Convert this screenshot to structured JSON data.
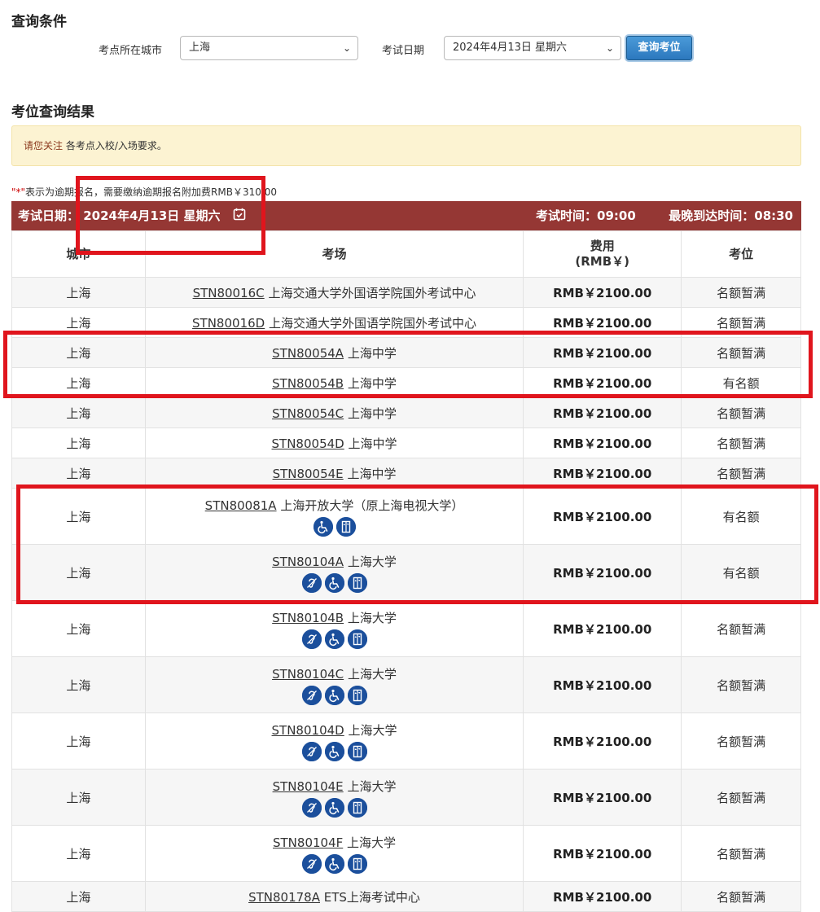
{
  "query": {
    "title": "查询条件",
    "city_label": "考点所在城市",
    "city_value": "上海",
    "date_label": "考试日期",
    "date_value": "2024年4月13日 星期六",
    "button": "查询考位"
  },
  "results": {
    "title": "考位查询结果",
    "notice_highlight": "请您关注",
    "notice_text": " 各考点入校/入场要求。",
    "late_note_mark": "\"*\"",
    "late_note_text": "表示为逾期报名，需要缴纳逾期报名附加费RMB￥310.00",
    "band_date": "考试日期：  2024年4月13日 星期六",
    "band_time": "考试时间：09:00",
    "band_arrive": "最晚到达时间：08:30",
    "headers": {
      "city": "城市",
      "venue": "考场",
      "fee_line1": "费用",
      "fee_line2": "(RMB￥)",
      "seat": "考位"
    },
    "rows": [
      {
        "city": "上海",
        "code": "STN80016C",
        "name": " 上海交通大学外国语学院国外考试中心",
        "fee": "RMB￥2100.00",
        "seat": "名额暂满",
        "icons": []
      },
      {
        "city": "上海",
        "code": "STN80016D",
        "name": " 上海交通大学外国语学院国外考试中心",
        "fee": "RMB￥2100.00",
        "seat": "名额暂满",
        "icons": []
      },
      {
        "city": "上海",
        "code": "STN80054A",
        "name": " 上海中学",
        "fee": "RMB￥2100.00",
        "seat": "名额暂满",
        "icons": []
      },
      {
        "city": "上海",
        "code": "STN80054B",
        "name": " 上海中学",
        "fee": "RMB￥2100.00",
        "seat": "有名额",
        "icons": []
      },
      {
        "city": "上海",
        "code": "STN80054C",
        "name": " 上海中学",
        "fee": "RMB￥2100.00",
        "seat": "名额暂满",
        "icons": []
      },
      {
        "city": "上海",
        "code": "STN80054D",
        "name": " 上海中学",
        "fee": "RMB￥2100.00",
        "seat": "名额暂满",
        "icons": []
      },
      {
        "city": "上海",
        "code": "STN80054E",
        "name": " 上海中学",
        "fee": "RMB￥2100.00",
        "seat": "名额暂满",
        "icons": []
      },
      {
        "city": "上海",
        "code": "STN80081A",
        "name": " 上海开放大学（原上海电视大学）",
        "fee": "RMB￥2100.00",
        "seat": "有名额",
        "icons": [
          "wheelchair-icon",
          "elevator-icon"
        ]
      },
      {
        "city": "上海",
        "code": "STN80104A",
        "name": " 上海大学",
        "fee": "RMB￥2100.00",
        "seat": "有名额",
        "icons": [
          "hearing-icon",
          "wheelchair-icon",
          "elevator-icon"
        ]
      },
      {
        "city": "上海",
        "code": "STN80104B",
        "name": " 上海大学",
        "fee": "RMB￥2100.00",
        "seat": "名额暂满",
        "icons": [
          "hearing-icon",
          "wheelchair-icon",
          "elevator-icon"
        ]
      },
      {
        "city": "上海",
        "code": "STN80104C",
        "name": " 上海大学",
        "fee": "RMB￥2100.00",
        "seat": "名额暂满",
        "icons": [
          "hearing-icon",
          "wheelchair-icon",
          "elevator-icon"
        ]
      },
      {
        "city": "上海",
        "code": "STN80104D",
        "name": " 上海大学",
        "fee": "RMB￥2100.00",
        "seat": "名额暂满",
        "icons": [
          "hearing-icon",
          "wheelchair-icon",
          "elevator-icon"
        ]
      },
      {
        "city": "上海",
        "code": "STN80104E",
        "name": " 上海大学",
        "fee": "RMB￥2100.00",
        "seat": "名额暂满",
        "icons": [
          "hearing-icon",
          "wheelchair-icon",
          "elevator-icon"
        ]
      },
      {
        "city": "上海",
        "code": "STN80104F",
        "name": " 上海大学",
        "fee": "RMB￥2100.00",
        "seat": "名额暂满",
        "icons": [
          "hearing-icon",
          "wheelchair-icon",
          "elevator-icon"
        ]
      },
      {
        "city": "上海",
        "code": "STN80178A",
        "name": " ETS上海考试中心",
        "fee": "RMB￥2100.00",
        "seat": "名额暂满",
        "icons": []
      }
    ]
  },
  "colors": {
    "band": "#953734",
    "notice_bg": "#fcf3d2",
    "icon_bg": "#1b4f9c",
    "highlight_box": "#e0151d",
    "button": "#2c78be"
  }
}
